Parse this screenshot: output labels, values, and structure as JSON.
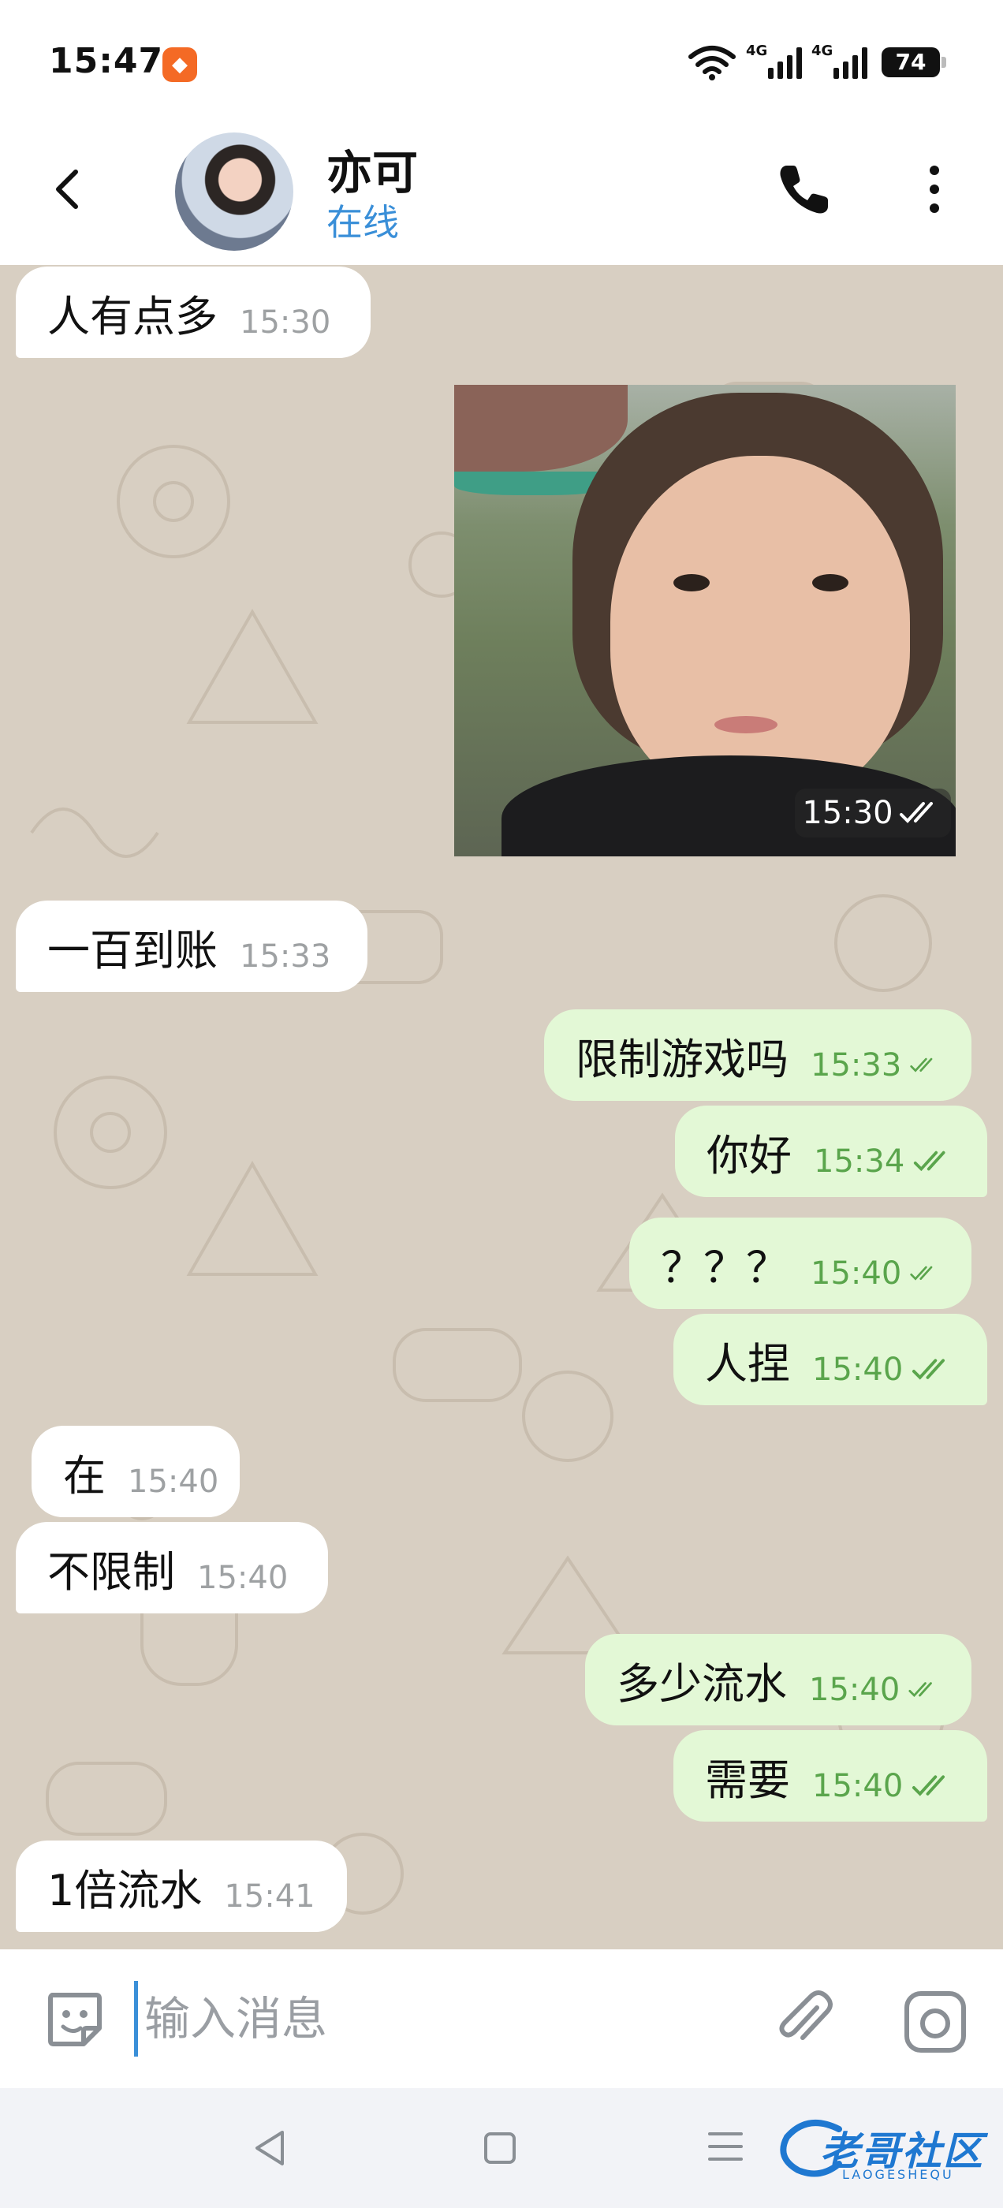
{
  "status_bar": {
    "time": "15:47",
    "network_1": "4G",
    "network_2": "4G",
    "battery": "74"
  },
  "header": {
    "contact_name": "亦可",
    "contact_status": "在线",
    "status_color": "#3a8fd8"
  },
  "messages": [
    {
      "direction": "in",
      "text": "人有点多",
      "time": "15:30"
    },
    {
      "direction": "out",
      "type": "image",
      "time": "15:30",
      "read": true
    },
    {
      "direction": "in",
      "text": "一百到账",
      "time": "15:33"
    },
    {
      "direction": "out",
      "text": "限制游戏吗",
      "time": "15:33",
      "read": true
    },
    {
      "direction": "out",
      "text": "你好",
      "time": "15:34",
      "read": true
    },
    {
      "direction": "out",
      "text": "？？？",
      "time": "15:40",
      "read": true
    },
    {
      "direction": "out",
      "text": "人捏",
      "time": "15:40",
      "read": true
    },
    {
      "direction": "in",
      "text": "在",
      "time": "15:40"
    },
    {
      "direction": "in",
      "text": "不限制",
      "time": "15:40"
    },
    {
      "direction": "out",
      "text": "多少流水",
      "time": "15:40",
      "read": true
    },
    {
      "direction": "out",
      "text": "需要",
      "time": "15:40",
      "read": true
    },
    {
      "direction": "in",
      "text": "1倍流水",
      "time": "15:41"
    }
  ],
  "composer": {
    "placeholder": "输入消息"
  },
  "watermark": {
    "text": "老哥社区",
    "sub": "LAOGESHEQU"
  },
  "colors": {
    "incoming_bubble": "#ffffff",
    "outgoing_bubble": "#e3f8d6",
    "chat_background": "#d8cfc2",
    "read_check": "#5aa54c"
  }
}
